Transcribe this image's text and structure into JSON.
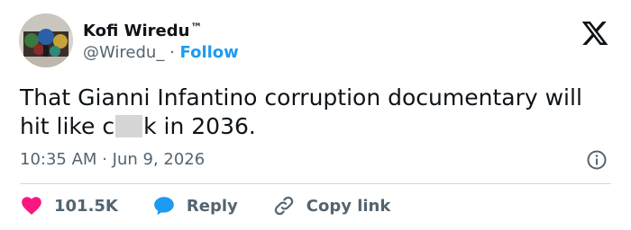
{
  "author": {
    "name": "Kofi Wiredu",
    "badge": "™",
    "handle": "@Wiredu_",
    "separator": "·",
    "follow_label": "Follow"
  },
  "tweet": {
    "text_before": "That Gianni Infantino corruption documentary will hit like c",
    "text_after": "k in 2036.",
    "time": "10:35 AM",
    "separator": "·",
    "date": "Jun 9, 2026"
  },
  "actions": {
    "likes_count": "101.5K",
    "reply_label": "Reply",
    "copy_label": "Copy link"
  },
  "icons": {
    "brand": "x-logo-icon",
    "info": "info-icon",
    "like": "heart-icon",
    "reply": "speech-bubble-icon",
    "copy": "link-icon"
  },
  "colors": {
    "accent": "#1d9bf0",
    "like": "#f91880",
    "muted": "#536471",
    "text": "#0f1419"
  }
}
